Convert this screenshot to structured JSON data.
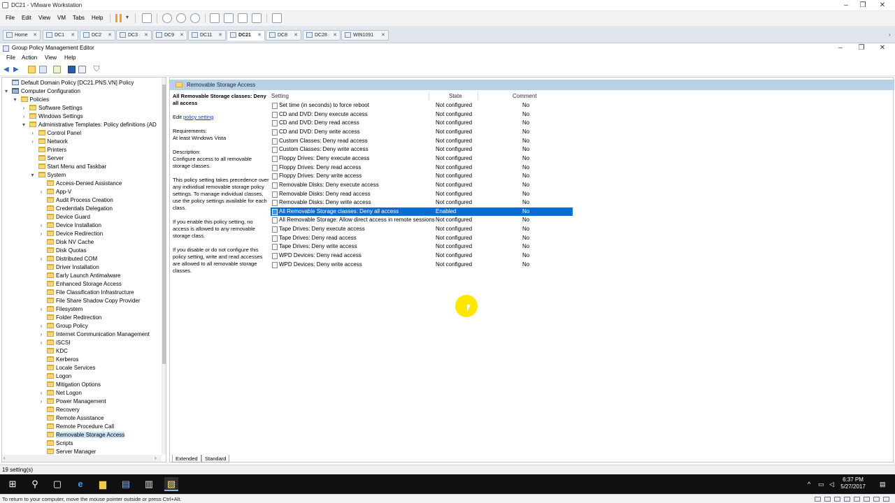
{
  "vmware": {
    "title": "DC21 - VMware Workstation",
    "menu": [
      "File",
      "Edit",
      "View",
      "VM",
      "Tabs",
      "Help"
    ],
    "tabs": [
      {
        "label": "Home",
        "active": false
      },
      {
        "label": "DC1",
        "active": false
      },
      {
        "label": "DC2",
        "active": false
      },
      {
        "label": "DC3",
        "active": false
      },
      {
        "label": "DC9",
        "active": false
      },
      {
        "label": "DC11",
        "active": false
      },
      {
        "label": "DC21",
        "active": true
      },
      {
        "label": "DC8",
        "active": false
      },
      {
        "label": "DC28",
        "active": false
      },
      {
        "label": "WIN1091",
        "active": false
      }
    ],
    "hint": "To return to your computer, move the mouse pointer outside or press Ctrl+Alt."
  },
  "gpme": {
    "title": "Group Policy Management Editor",
    "menu": [
      "File",
      "Action",
      "View",
      "Help"
    ],
    "status": "19 setting(s)"
  },
  "tree": [
    {
      "label": "Default Domain Policy [DC21.PNS.VN] Policy",
      "level": 0,
      "expander": "",
      "type": "policy"
    },
    {
      "label": "Computer Configuration",
      "level": 0,
      "expander": "▾",
      "type": "computer"
    },
    {
      "label": "Policies",
      "level": 1,
      "expander": "▾",
      "type": "folder"
    },
    {
      "label": "Software Settings",
      "level": 2,
      "expander": "›",
      "type": "folder"
    },
    {
      "label": "Windows Settings",
      "level": 2,
      "expander": "›",
      "type": "folder"
    },
    {
      "label": "Administrative Templates: Policy definitions (AD",
      "level": 2,
      "expander": "▾",
      "type": "folder"
    },
    {
      "label": "Control Panel",
      "level": 3,
      "expander": "›",
      "type": "folder"
    },
    {
      "label": "Network",
      "level": 3,
      "expander": "›",
      "type": "folder"
    },
    {
      "label": "Printers",
      "level": 3,
      "expander": "",
      "type": "folder"
    },
    {
      "label": "Server",
      "level": 3,
      "expander": "",
      "type": "folder"
    },
    {
      "label": "Start Menu and Taskbar",
      "level": 3,
      "expander": "",
      "type": "folder"
    },
    {
      "label": "System",
      "level": 3,
      "expander": "▾",
      "type": "folder"
    },
    {
      "label": "Access-Denied Assistance",
      "level": 4,
      "expander": "",
      "type": "folder"
    },
    {
      "label": "App-V",
      "level": 4,
      "expander": "›",
      "type": "folder"
    },
    {
      "label": "Audit Process Creation",
      "level": 4,
      "expander": "",
      "type": "folder"
    },
    {
      "label": "Credentials Delegation",
      "level": 4,
      "expander": "",
      "type": "folder"
    },
    {
      "label": "Device Guard",
      "level": 4,
      "expander": "",
      "type": "folder"
    },
    {
      "label": "Device Installation",
      "level": 4,
      "expander": "›",
      "type": "folder"
    },
    {
      "label": "Device Redirection",
      "level": 4,
      "expander": "›",
      "type": "folder"
    },
    {
      "label": "Disk NV Cache",
      "level": 4,
      "expander": "",
      "type": "folder"
    },
    {
      "label": "Disk Quotas",
      "level": 4,
      "expander": "",
      "type": "folder"
    },
    {
      "label": "Distributed COM",
      "level": 4,
      "expander": "›",
      "type": "folder"
    },
    {
      "label": "Driver Installation",
      "level": 4,
      "expander": "",
      "type": "folder"
    },
    {
      "label": "Early Launch Antimalware",
      "level": 4,
      "expander": "",
      "type": "folder"
    },
    {
      "label": "Enhanced Storage Access",
      "level": 4,
      "expander": "",
      "type": "folder"
    },
    {
      "label": "File Classification Infrastructure",
      "level": 4,
      "expander": "",
      "type": "folder"
    },
    {
      "label": "File Share Shadow Copy Provider",
      "level": 4,
      "expander": "",
      "type": "folder"
    },
    {
      "label": "Filesystem",
      "level": 4,
      "expander": "›",
      "type": "folder"
    },
    {
      "label": "Folder Redirection",
      "level": 4,
      "expander": "",
      "type": "folder"
    },
    {
      "label": "Group Policy",
      "level": 4,
      "expander": "›",
      "type": "folder"
    },
    {
      "label": "Internet Communication Management",
      "level": 4,
      "expander": "›",
      "type": "folder"
    },
    {
      "label": "iSCSI",
      "level": 4,
      "expander": "›",
      "type": "folder"
    },
    {
      "label": "KDC",
      "level": 4,
      "expander": "",
      "type": "folder"
    },
    {
      "label": "Kerberos",
      "level": 4,
      "expander": "",
      "type": "folder"
    },
    {
      "label": "Locale Services",
      "level": 4,
      "expander": "",
      "type": "folder"
    },
    {
      "label": "Logon",
      "level": 4,
      "expander": "",
      "type": "folder"
    },
    {
      "label": "Mitigation Options",
      "level": 4,
      "expander": "",
      "type": "folder"
    },
    {
      "label": "Net Logon",
      "level": 4,
      "expander": "›",
      "type": "folder"
    },
    {
      "label": "Power Management",
      "level": 4,
      "expander": "›",
      "type": "folder"
    },
    {
      "label": "Recovery",
      "level": 4,
      "expander": "",
      "type": "folder"
    },
    {
      "label": "Remote Assistance",
      "level": 4,
      "expander": "",
      "type": "folder"
    },
    {
      "label": "Remote Procedure Call",
      "level": 4,
      "expander": "",
      "type": "folder"
    },
    {
      "label": "Removable Storage Access",
      "level": 4,
      "expander": "",
      "type": "folder",
      "selected": true
    },
    {
      "label": "Scripts",
      "level": 4,
      "expander": "",
      "type": "folder"
    },
    {
      "label": "Server Manager",
      "level": 4,
      "expander": "",
      "type": "folder"
    }
  ],
  "pane": {
    "header": "Removable Storage Access",
    "desc_title": "All Removable Storage classes: Deny all access",
    "edit_prefix": "Edit ",
    "edit_link": "policy setting",
    "requirements_label": "Requirements:",
    "requirements": "At least Windows Vista",
    "description_label": "Description:",
    "description": "Configure access to all removable storage classes.",
    "para1": "This policy setting takes precedence over any individual removable storage policy settings. To manage individual classes, use the policy settings available for each class.",
    "para2": "If you enable this policy setting, no access is allowed to any removable storage class.",
    "para3": "If you disable or do not configure this policy setting, write and read accesses are allowed to all removable storage classes.",
    "columns": {
      "setting": "Setting",
      "state": "State",
      "comment": "Comment"
    },
    "rows": [
      {
        "setting": "Set time (in seconds) to force reboot",
        "state": "Not configured",
        "comment": "No"
      },
      {
        "setting": "CD and DVD: Deny execute access",
        "state": "Not configured",
        "comment": "No"
      },
      {
        "setting": "CD and DVD: Deny read access",
        "state": "Not configured",
        "comment": "No"
      },
      {
        "setting": "CD and DVD: Deny write access",
        "state": "Not configured",
        "comment": "No"
      },
      {
        "setting": "Custom Classes: Deny read access",
        "state": "Not configured",
        "comment": "No"
      },
      {
        "setting": "Custom Classes: Deny write access",
        "state": "Not configured",
        "comment": "No"
      },
      {
        "setting": "Floppy Drives: Deny execute access",
        "state": "Not configured",
        "comment": "No"
      },
      {
        "setting": "Floppy Drives: Deny read access",
        "state": "Not configured",
        "comment": "No"
      },
      {
        "setting": "Floppy Drives: Deny write access",
        "state": "Not configured",
        "comment": "No"
      },
      {
        "setting": "Removable Disks: Deny execute access",
        "state": "Not configured",
        "comment": "No"
      },
      {
        "setting": "Removable Disks: Deny read access",
        "state": "Not configured",
        "comment": "No"
      },
      {
        "setting": "Removable Disks: Deny write access",
        "state": "Not configured",
        "comment": "No"
      },
      {
        "setting": "All Removable Storage classes: Deny all access",
        "state": "Enabled",
        "comment": "No",
        "selected": true
      },
      {
        "setting": "All Removable Storage: Allow direct access in remote sessions",
        "state": "Not configured",
        "comment": "No"
      },
      {
        "setting": "Tape Drives: Deny execute access",
        "state": "Not configured",
        "comment": "No"
      },
      {
        "setting": "Tape Drives: Deny read access",
        "state": "Not configured",
        "comment": "No"
      },
      {
        "setting": "Tape Drives: Deny write access",
        "state": "Not configured",
        "comment": "No"
      },
      {
        "setting": "WPD Devices: Deny read access",
        "state": "Not configured",
        "comment": "No"
      },
      {
        "setting": "WPD Devices: Deny write access",
        "state": "Not configured",
        "comment": "No"
      }
    ],
    "view_tabs": [
      "Extended",
      "Standard"
    ]
  },
  "taskbar": {
    "time": "6:37 PM",
    "date": "5/27/2017"
  },
  "colors": {
    "selection": "#0a6bd3",
    "header_band": "#b9d0e6",
    "cursor_highlight": "#ffe600",
    "taskbar": "#101010"
  }
}
